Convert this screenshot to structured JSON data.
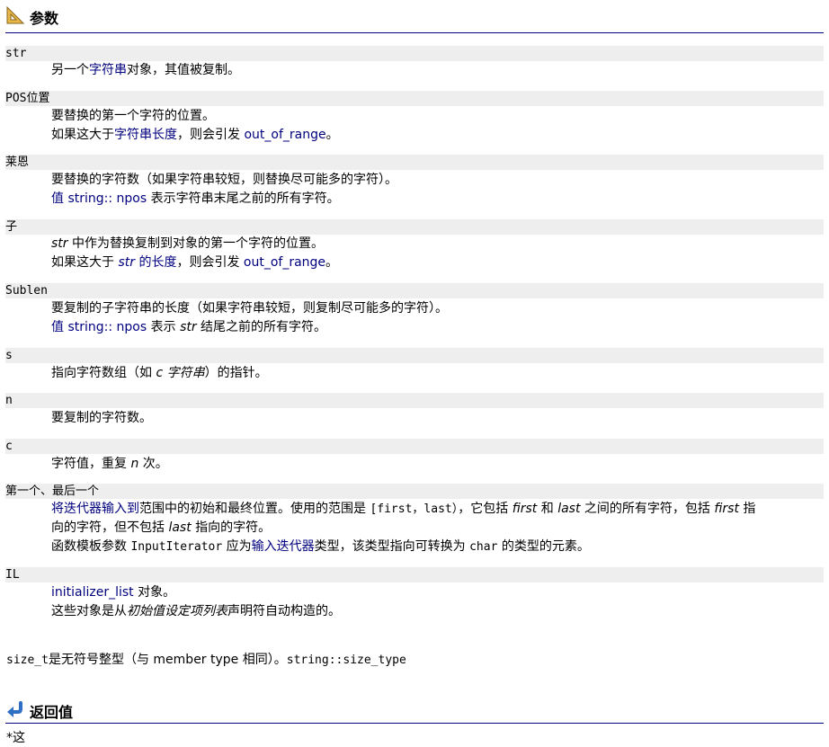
{
  "params_section": {
    "title": "参数",
    "icon": "triangle-ruler-icon"
  },
  "str": {
    "term": "str",
    "lines": [
      {
        "link": "字符串",
        "pre": "另一个",
        "post": "对象，其值被复制。"
      }
    ]
  },
  "pos": {
    "term": "POS位置",
    "l1": "要替换的第一个字符的位置。",
    "l2_pre": "如果这大于",
    "l2_link": "字符串长度",
    "l2_mid": "，则会引发 ",
    "l2_link2": "out_of_range",
    "l2_post": "。"
  },
  "len": {
    "term": "莱恩",
    "l1": "要替换的字符数（如果字符串较短，则替换尽可能多的字符）。",
    "l2_link": "值 string:: npos",
    "l2_post": " 表示字符串末尾之前的所有字符。"
  },
  "subpos": {
    "term": "子",
    "l1_it": "str",
    "l1_post": " 中作为替换复制到对象的第一个字符的位置。",
    "l2_pre": "如果这大于 ",
    "l2_it": "str",
    "l2_link": " 的长度",
    "l2_mid": "，则会引发 ",
    "l2_link2": "out_of_range",
    "l2_post": "。"
  },
  "sublen": {
    "term": "Sublen",
    "l1": "要复制的子字符串的长度（如果字符串较短，则复制尽可能多的字符）。",
    "l2_link": "值 string:: npos",
    "l2_mid": " 表示 ",
    "l2_it": "str",
    "l2_post": " 结尾之前的所有字符。"
  },
  "s": {
    "term": "s",
    "pre": "指向字符数组（如 ",
    "it": "c 字符串",
    "post": "）的指针。"
  },
  "n": {
    "term": "n",
    "text": "要复制的字符数。"
  },
  "c": {
    "term": "c",
    "pre": "字符值，重复 ",
    "it": "n",
    "post": " 次。"
  },
  "first_last": {
    "term": "第一个、最后一个",
    "l1_link": "将迭代器输入到",
    "l1_a": "范围中的初始和最终位置。使用的范围是 ",
    "l1_mono": "[first，last）",
    "l1_b": "，它包括 ",
    "l1_it1": "first",
    "l1_c": " 和 ",
    "l1_it2": "last",
    "l1_d": " 之间的所有字符，包括 ",
    "l1_it3": "first",
    "l1_e": " 指",
    "l2_a": "向的字符，但不包括 ",
    "l2_it": "last",
    "l2_b": " 指向的字符。",
    "l3_a": "函数模板参数 ",
    "l3_mono1": "InputIterator",
    "l3_b": " 应为",
    "l3_link": "输入迭代器",
    "l3_c": "类型，该类型指向可转换为 ",
    "l3_mono2": "char",
    "l3_d": " 的类型的元素。"
  },
  "il": {
    "term": "IL",
    "l1_link": "initializer_list",
    "l1_post": " 对象。",
    "l2_a": "这些对象是从",
    "l2_it": "初始值设定项列表",
    "l2_b": "声明符自动构造的。"
  },
  "size_note": {
    "mono1": "size_t",
    "a": "是无符号整型（与 member type 相同）。",
    "mono2": "string::size_type"
  },
  "return_section": {
    "title": "返回值",
    "icon": "return-arrow-icon"
  },
  "return_text": "*这"
}
